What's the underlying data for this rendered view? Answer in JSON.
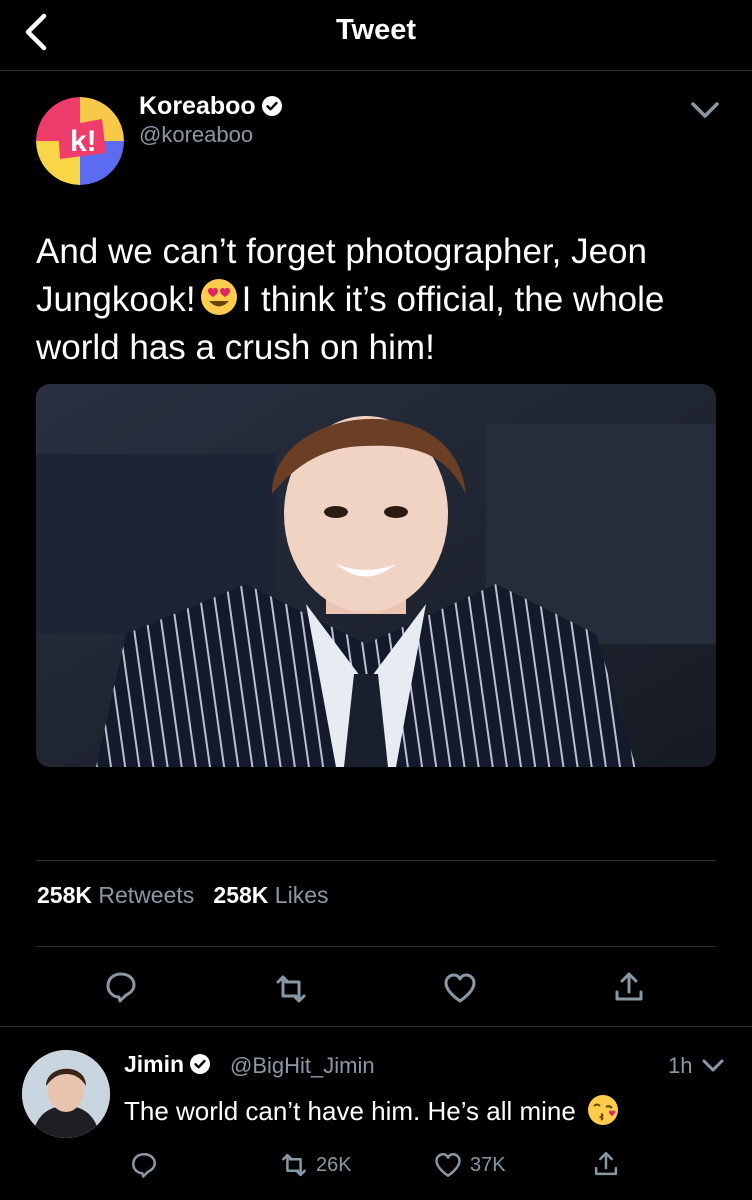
{
  "header": {
    "title": "Tweet",
    "back_icon": "chevron-left-icon"
  },
  "tweet": {
    "author_name": "Koreaboo",
    "author_handle": "@koreaboo",
    "text_part1": "And we can’t forget photographer, Jeon Jungkook!",
    "text_part2": "I think it’s official, the whole world has a crush on him!",
    "emoji": "heart-eyes-emoji",
    "retweets_count": "258K",
    "retweets_label": "Retweets",
    "likes_count": "258K",
    "likes_label": "Likes"
  },
  "reply": {
    "author_name": "Jimin",
    "author_handle": "@BigHit_Jimin",
    "time": "1h",
    "text": "The world can’t have him. He’s all mine",
    "emoji": "kissing-face-emoji",
    "retweets": "26K",
    "likes": "37K"
  },
  "colors": {
    "background": "#000000",
    "secondary_text": "#8899a6",
    "divider": "#2f3336",
    "verified": "#ffffff"
  }
}
